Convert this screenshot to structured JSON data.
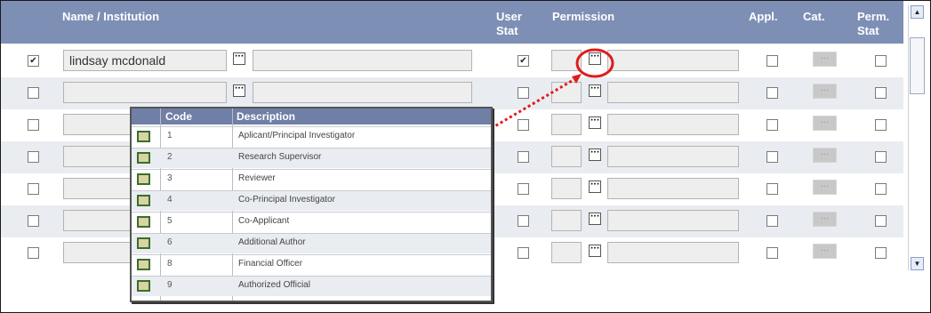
{
  "header": {
    "name": "Name / Institution",
    "user_stat_1": "User",
    "user_stat_2": "Stat",
    "permission": "Permission",
    "appl": "Appl.",
    "cat": "Cat.",
    "perm_stat_1": "Perm.",
    "perm_stat_2": "Stat"
  },
  "rows": [
    {
      "selected": "✔",
      "name": "lindsay mcdonald",
      "user_stat": "✔"
    },
    {
      "selected": "",
      "name": "",
      "user_stat": ""
    },
    {
      "selected": "",
      "name": "",
      "user_stat": ""
    },
    {
      "selected": "",
      "name": "",
      "user_stat": ""
    },
    {
      "selected": "",
      "name": "",
      "user_stat": ""
    },
    {
      "selected": "",
      "name": "",
      "user_stat": ""
    },
    {
      "selected": "",
      "name": "",
      "user_stat": ""
    }
  ],
  "button_glyph": "···",
  "cat_glyph": "···",
  "popup": {
    "code_header": "Code",
    "desc_header": "Description",
    "items": [
      {
        "code": "1",
        "description": "Aplicant/Principal Investigator"
      },
      {
        "code": "2",
        "description": "Research Supervisor"
      },
      {
        "code": "3",
        "description": "Reviewer"
      },
      {
        "code": "4",
        "description": "Co-Principal Investigator"
      },
      {
        "code": "5",
        "description": "Co-Applicant"
      },
      {
        "code": "6",
        "description": "Additional Author"
      },
      {
        "code": "8",
        "description": "Financial Officer"
      },
      {
        "code": "9",
        "description": "Authorized Official"
      }
    ]
  },
  "scroll": {
    "up": "▲",
    "down": "▼"
  },
  "colors": {
    "header": "#7e8fb5",
    "annotation": "#e01b1b",
    "row_alt": "#e9ecf1"
  }
}
